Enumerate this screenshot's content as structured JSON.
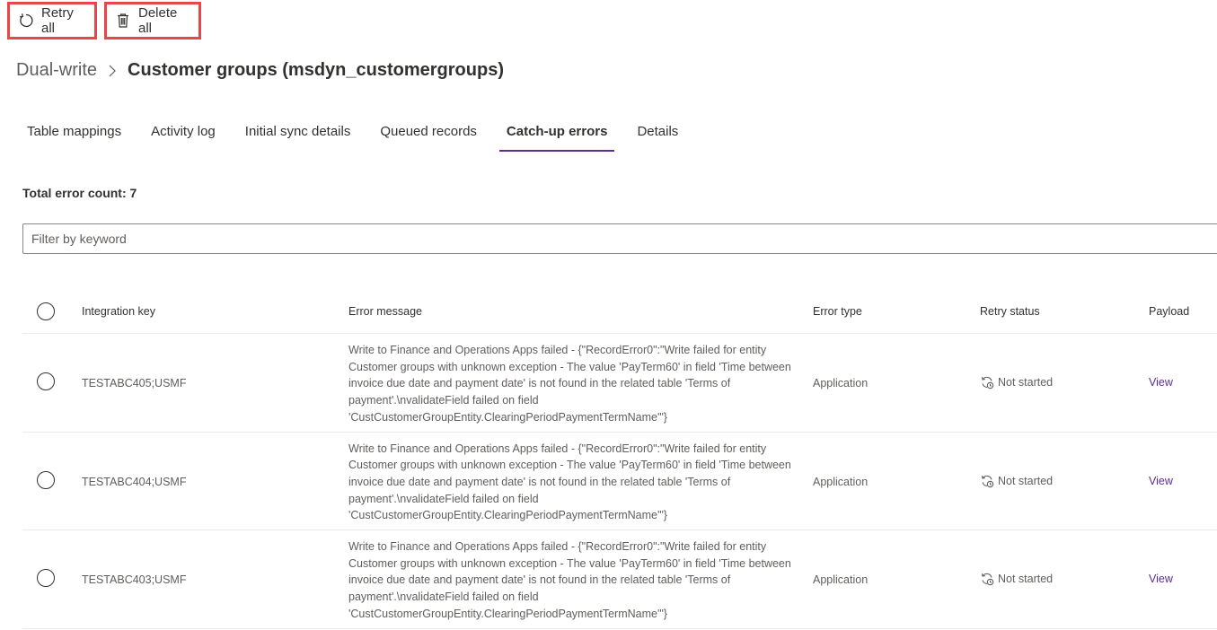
{
  "toolbar": {
    "retry_label": "Retry all",
    "delete_label": "Delete all",
    "retry_icon": "refresh-icon",
    "delete_icon": "trash-icon"
  },
  "breadcrumb": {
    "root": "Dual-write",
    "current": "Customer groups (msdyn_customergroups)"
  },
  "tabs": [
    {
      "label": "Table mappings",
      "active": false
    },
    {
      "label": "Activity log",
      "active": false
    },
    {
      "label": "Initial sync details",
      "active": false
    },
    {
      "label": "Queued records",
      "active": false
    },
    {
      "label": "Catch-up errors",
      "active": true
    },
    {
      "label": "Details",
      "active": false
    }
  ],
  "summary": {
    "error_count_text": "Total error count: 7"
  },
  "filter": {
    "placeholder": "Filter by keyword",
    "value": ""
  },
  "table": {
    "columns": {
      "key": "Integration key",
      "message": "Error message",
      "type": "Error type",
      "status": "Retry status",
      "payload": "Payload"
    },
    "rows": [
      {
        "key": "TESTABC405;USMF",
        "message": "Write to Finance and Operations Apps failed - {\"RecordError0\":\"Write failed for entity Customer groups with unknown exception - The value 'PayTerm60' in field 'Time between invoice due date and payment date' is not found in the related table 'Terms of payment'.\\nvalidateField failed on field 'CustCustomerGroupEntity.ClearingPeriodPaymentTermName'\"}",
        "type": "Application",
        "status": "Not started",
        "payload": "View"
      },
      {
        "key": "TESTABC404;USMF",
        "message": "Write to Finance and Operations Apps failed - {\"RecordError0\":\"Write failed for entity Customer groups with unknown exception - The value 'PayTerm60' in field 'Time between invoice due date and payment date' is not found in the related table 'Terms of payment'.\\nvalidateField failed on field 'CustCustomerGroupEntity.ClearingPeriodPaymentTermName'\"}",
        "type": "Application",
        "status": "Not started",
        "payload": "View"
      },
      {
        "key": "TESTABC403;USMF",
        "message": "Write to Finance and Operations Apps failed - {\"RecordError0\":\"Write failed for entity Customer groups with unknown exception - The value 'PayTerm60' in field 'Time between invoice due date and payment date' is not found in the related table 'Terms of payment'.\\nvalidateField failed on field 'CustCustomerGroupEntity.ClearingPeriodPaymentTermName'\"}",
        "type": "Application",
        "status": "Not started",
        "payload": "View"
      }
    ]
  },
  "colors": {
    "accent": "#5c2e91",
    "highlight_border": "#e8474a",
    "text": "#323130",
    "muted_text": "#605e5c"
  }
}
